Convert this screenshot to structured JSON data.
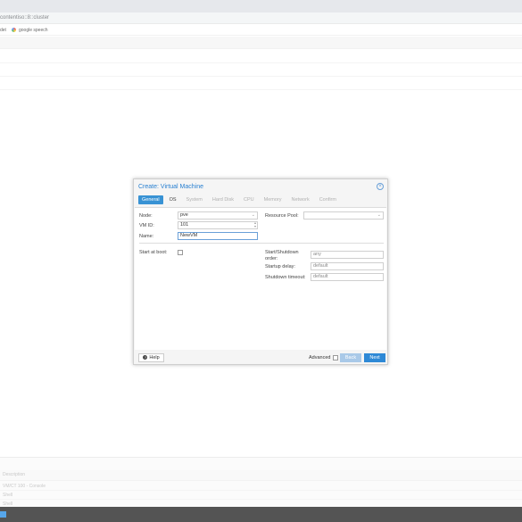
{
  "browser": {
    "address_text": "contentiso::8::cluster",
    "bookmarks": [
      {
        "label": "det"
      },
      {
        "label": "google speech"
      }
    ]
  },
  "dialog": {
    "title": "Create: Virtual Machine",
    "tabs": [
      {
        "label": "General",
        "state": "active"
      },
      {
        "label": "OS",
        "state": "enabled"
      },
      {
        "label": "System",
        "state": "disabled"
      },
      {
        "label": "Hard Disk",
        "state": "disabled"
      },
      {
        "label": "CPU",
        "state": "disabled"
      },
      {
        "label": "Memory",
        "state": "disabled"
      },
      {
        "label": "Network",
        "state": "disabled"
      },
      {
        "label": "Confirm",
        "state": "disabled"
      }
    ],
    "fields": {
      "node_label": "Node:",
      "node_value": "pve",
      "vmid_label": "VM ID:",
      "vmid_value": "101",
      "name_label": "Name:",
      "name_value": "NewVM",
      "pool_label": "Resource Pool:",
      "pool_value": "",
      "start_boot_label": "Start at boot:",
      "start_boot_checked": false,
      "order_label": "Start/Shutdown order:",
      "order_value": "any",
      "delay_label": "Startup delay:",
      "delay_value": "default",
      "timeout_label": "Shutdown timeout:",
      "timeout_value": "default"
    },
    "footer": {
      "help_label": "Help",
      "advanced_label": "Advanced",
      "advanced_checked": false,
      "back_label": "Back",
      "next_label": "Next"
    }
  },
  "log_panel": {
    "header_label": "Description",
    "rows": [
      "VM/CT 100 - Console",
      "Shell",
      "Shell"
    ]
  },
  "colors": {
    "accent": "#3892d4",
    "next_button": "#2e89d6",
    "back_button_disabled": "#a9c9e8",
    "title": "#2980d1"
  }
}
